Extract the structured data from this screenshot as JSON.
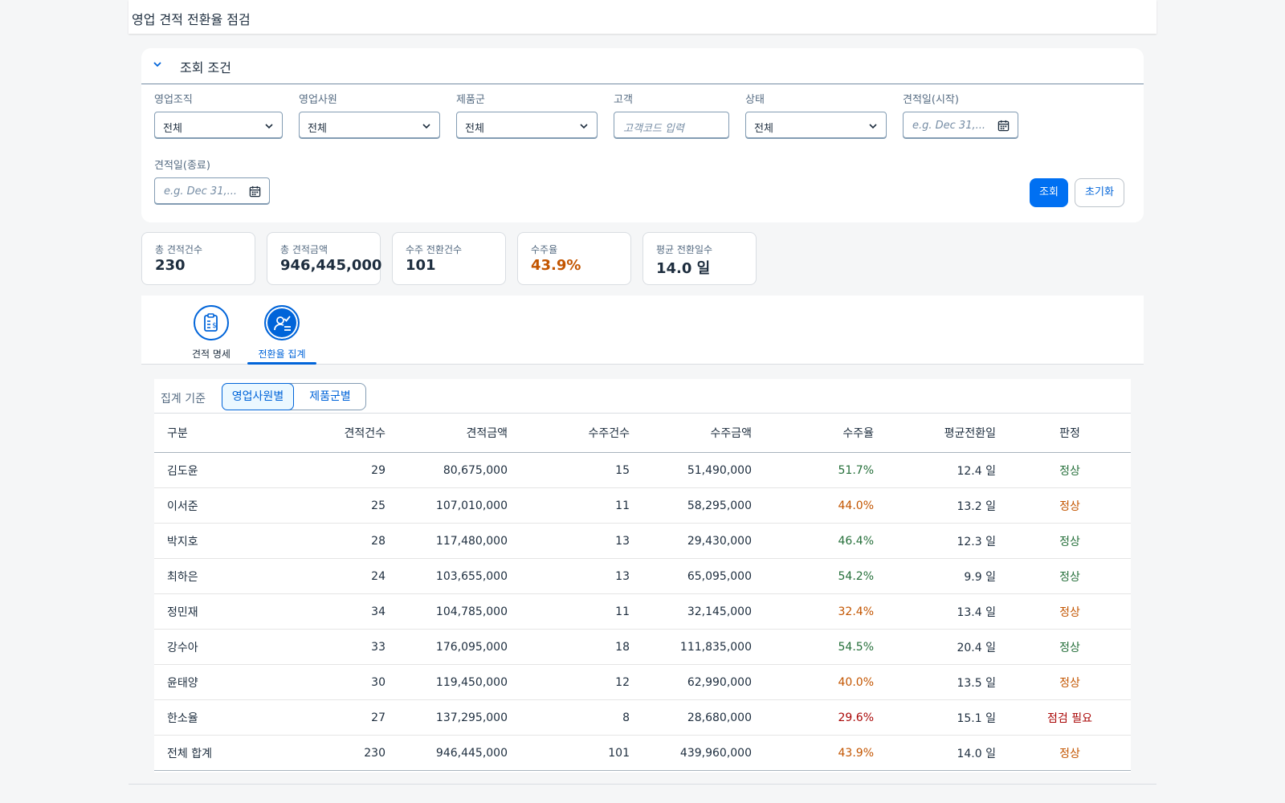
{
  "app": {
    "title": "영업 견적 전환율 점검"
  },
  "filter": {
    "title": "조회 조건",
    "fields": {
      "org": {
        "label": "영업조직",
        "value": "전체"
      },
      "rep": {
        "label": "영업사원",
        "value": "전체"
      },
      "product": {
        "label": "제품군",
        "value": "전체"
      },
      "customer": {
        "label": "고객",
        "placeholder": "고객코드 입력"
      },
      "status": {
        "label": "상태",
        "value": "전체"
      },
      "date_from": {
        "label": "견적일(시작)",
        "placeholder": "e.g. Dec 31,..."
      },
      "date_to": {
        "label": "견적일(종료)",
        "placeholder": "e.g. Dec 31,..."
      }
    },
    "search_label": "조회",
    "reset_label": "초기화"
  },
  "kpis": [
    {
      "label": "총 견적건수",
      "value": "230"
    },
    {
      "label": "총 견적금액",
      "value": "946,445,000"
    },
    {
      "label": "수주 전환건수",
      "value": "101"
    },
    {
      "label": "수주율",
      "value": "43.9%"
    },
    {
      "label": "평균 전환일수",
      "value": "14.0 일"
    }
  ],
  "tabs": [
    {
      "label": "견적 명세",
      "icon": "clipboard-money-icon"
    },
    {
      "label": "전환율 집계",
      "icon": "user-check-icon",
      "selected": true
    }
  ],
  "aggregate": {
    "label": "집계 기준",
    "options": [
      "영업사원별",
      "제품군별"
    ],
    "selected": "영업사원별"
  },
  "table": {
    "columns": [
      "구분",
      "견적건수",
      "견적금액",
      "수주건수",
      "수주금액",
      "수주율",
      "평균전환일",
      "판정"
    ],
    "rows": [
      [
        "김도윤",
        "29",
        "80,675,000",
        "15",
        "51,490,000",
        "51.7%",
        "12.4 일",
        "정상"
      ],
      [
        "이서준",
        "25",
        "107,010,000",
        "11",
        "58,295,000",
        "44.0%",
        "13.2 일",
        "정상"
      ],
      [
        "박지호",
        "28",
        "117,480,000",
        "13",
        "29,430,000",
        "46.4%",
        "12.3 일",
        "정상"
      ],
      [
        "최하은",
        "24",
        "103,655,000",
        "13",
        "65,095,000",
        "54.2%",
        "9.9 일",
        "정상"
      ],
      [
        "정민재",
        "34",
        "104,785,000",
        "11",
        "32,145,000",
        "32.4%",
        "13.4 일",
        "정상"
      ],
      [
        "강수아",
        "33",
        "176,095,000",
        "18",
        "111,835,000",
        "54.5%",
        "20.4 일",
        "정상"
      ],
      [
        "윤태양",
        "30",
        "119,450,000",
        "12",
        "62,990,000",
        "40.0%",
        "13.5 일",
        "정상"
      ],
      [
        "한소율",
        "27",
        "137,295,000",
        "8",
        "28,680,000",
        "29.6%",
        "15.1 일",
        "점검 필요"
      ],
      [
        "전체 합계",
        "230",
        "946,445,000",
        "101",
        "439,960,000",
        "43.9%",
        "14.0 일",
        "정상"
      ]
    ],
    "row_tones": [
      "green",
      "orange",
      "green",
      "green",
      "orange",
      "green",
      "orange",
      "red",
      "orange"
    ]
  },
  "colors": {
    "accent": "#0070f2",
    "positive": "#256f3a",
    "warning": "#c35500",
    "negative": "#aa0808"
  }
}
